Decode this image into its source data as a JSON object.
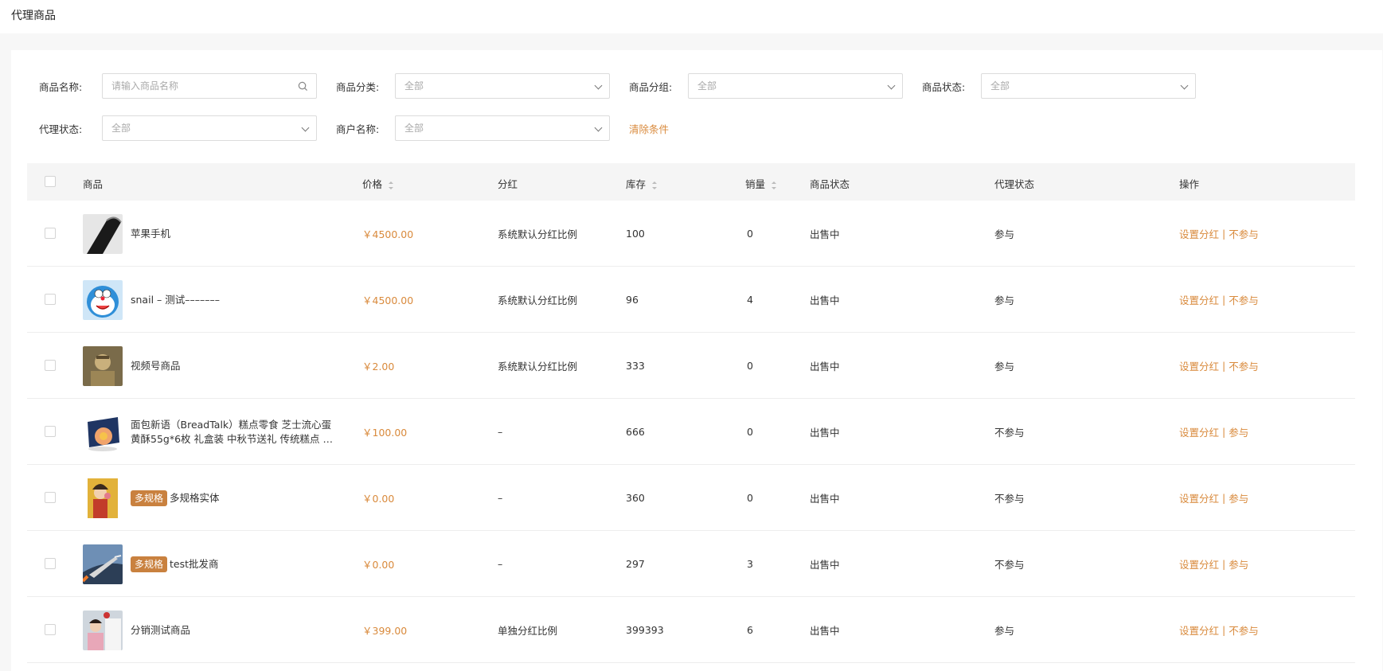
{
  "page": {
    "title": "代理商品"
  },
  "filters": {
    "name_label": "商品名称:",
    "name_placeholder": "请输入商品名称",
    "category_label": "商品分类:",
    "category_value": "全部",
    "group_label": "商品分组:",
    "group_value": "全部",
    "status_label": "商品状态:",
    "status_value": "全部",
    "agent_label": "代理状态:",
    "agent_value": "全部",
    "merchant_label": "商户名称:",
    "merchant_value": "全部",
    "clear_label": "清除条件"
  },
  "table": {
    "headers": {
      "product": "商品",
      "price": "价格",
      "dividend": "分红",
      "stock": "库存",
      "sales": "销量",
      "status": "商品状态",
      "agent": "代理状态",
      "ops": "操作"
    },
    "op_set": "设置分红",
    "op_sep": "|",
    "rows": [
      {
        "tag": "",
        "name": "苹果手机",
        "price": "￥4500.00",
        "dividend": "系统默认分红比例",
        "stock": "100",
        "sales": "0",
        "status": "出售中",
        "agent": "参与",
        "op2": "不参与",
        "thumb": "phone"
      },
      {
        "tag": "",
        "name": "snail – 测试–––––––",
        "price": "￥4500.00",
        "dividend": "系统默认分红比例",
        "stock": "96",
        "sales": "4",
        "status": "出售中",
        "agent": "参与",
        "op2": "不参与",
        "thumb": "doraemon"
      },
      {
        "tag": "",
        "name": "视频号商品",
        "price": "￥2.00",
        "dividend": "系统默认分红比例",
        "stock": "333",
        "sales": "0",
        "status": "出售中",
        "agent": "参与",
        "op2": "不参与",
        "thumb": "statue"
      },
      {
        "tag": "",
        "name": "面包新语（BreadTalk）糕点零食 芝士流心蛋黄酥55g*6枚 礼盒装 中秋节送礼 传统糕点 休闲零食",
        "price": "￥100.00",
        "dividend": "–",
        "stock": "666",
        "sales": "0",
        "status": "出售中",
        "agent": "不参与",
        "op2": "参与",
        "thumb": "giftbox"
      },
      {
        "tag": "多规格",
        "name": "多规格实体",
        "price": "￥0.00",
        "dividend": "–",
        "stock": "360",
        "sales": "0",
        "status": "出售中",
        "agent": "不参与",
        "op2": "参与",
        "thumb": "girl"
      },
      {
        "tag": "多规格",
        "name": "test批发商",
        "price": "￥0.00",
        "dividend": "–",
        "stock": "297",
        "sales": "3",
        "status": "出售中",
        "agent": "不参与",
        "op2": "参与",
        "thumb": "jet"
      },
      {
        "tag": "",
        "name": "分销测试商品",
        "price": "￥399.00",
        "dividend": "单独分红比例",
        "stock": "399393",
        "sales": "6",
        "status": "出售中",
        "agent": "参与",
        "op2": "不参与",
        "thumb": "people"
      }
    ]
  }
}
